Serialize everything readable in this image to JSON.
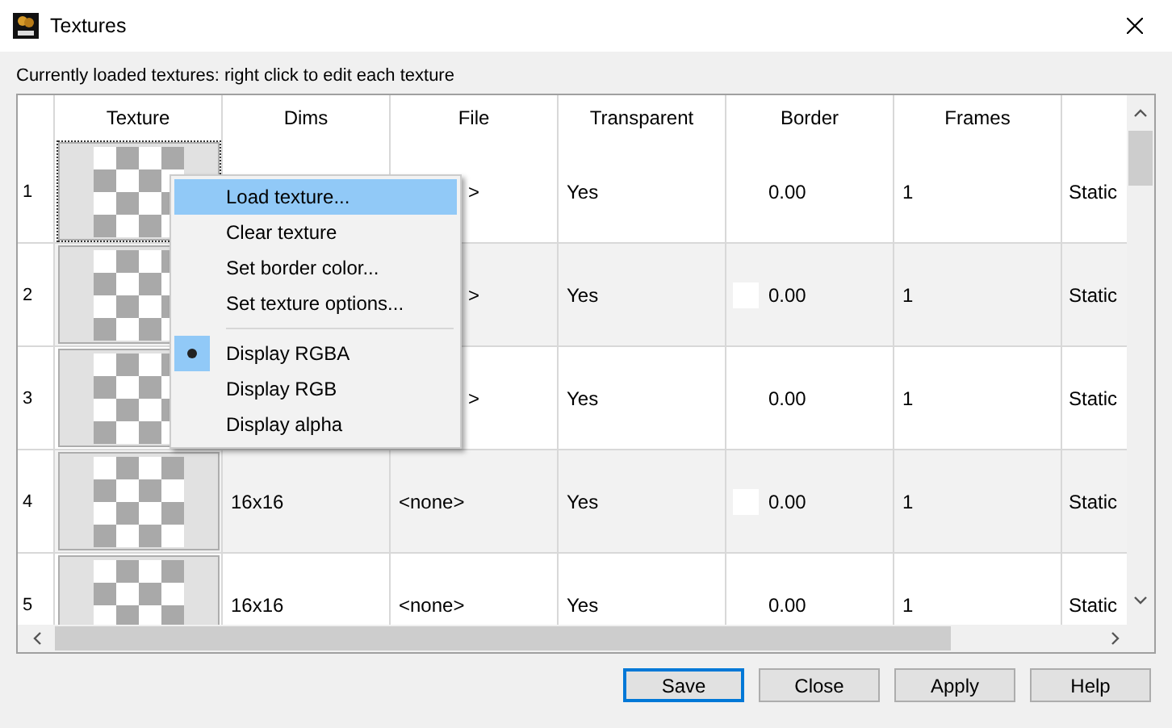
{
  "window": {
    "title": "Textures"
  },
  "caption": "Currently loaded textures: right click to edit each texture",
  "table": {
    "columns": [
      "Texture",
      "Dims",
      "File",
      "Transparent",
      "Border",
      "Frames"
    ],
    "rows": [
      {
        "number": "1",
        "focused": true,
        "file": ">",
        "transparent": "Yes",
        "border": "0.00",
        "frames": "1",
        "column_7": "Static"
      },
      {
        "number": "2",
        "focused": false,
        "file": ">",
        "transparent": "Yes",
        "border": "0.00",
        "color": "#ffffff",
        "frames": "1",
        "column_7": "Static"
      },
      {
        "number": "3",
        "focused": false,
        "file": ">",
        "transparent": "Yes",
        "border": "0.00",
        "frames": "1",
        "column_7": "Static"
      },
      {
        "number": "4",
        "focused": false,
        "dims": "16x16",
        "file": "<none>",
        "transparent": "Yes",
        "border": "0.00",
        "color": "#ffffff",
        "frames": "1",
        "column_7": "Static"
      },
      {
        "number": "5",
        "focused": false,
        "dims": "16x16",
        "file": "<none>",
        "transparent": "Yes",
        "border": "0.00",
        "frames": "1",
        "column_7": "Static"
      }
    ]
  },
  "context_menu": {
    "groups": [
      [
        {
          "label": "Load texture...",
          "selected": true
        },
        {
          "label": "Clear texture",
          "selected": false
        },
        {
          "label": "Set border color...",
          "selected": false
        },
        {
          "label": "Set texture options...",
          "selected": false
        }
      ],
      [
        {
          "label": "Display RGBA",
          "selected": false,
          "checked": true
        },
        {
          "label": "Display RGB",
          "selected": false,
          "checked": false
        },
        {
          "label": "Display alpha",
          "selected": false,
          "checked": false
        }
      ]
    ]
  },
  "buttons": [
    {
      "label": "Save",
      "default": true
    },
    {
      "label": "Close",
      "default": false
    },
    {
      "label": "Apply",
      "default": false
    },
    {
      "label": "Help",
      "default": false
    }
  ]
}
